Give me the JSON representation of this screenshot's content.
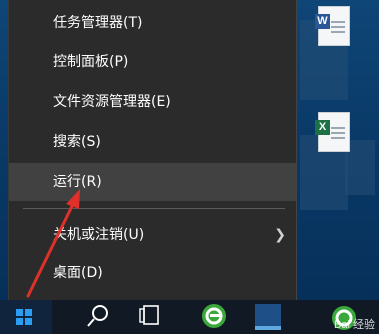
{
  "context_menu": {
    "items": [
      {
        "label": "任务管理器(T)"
      },
      {
        "label": "控制面板(P)"
      },
      {
        "label": "文件资源管理器(E)"
      },
      {
        "label": "搜索(S)"
      },
      {
        "label": "运行(R)"
      },
      {
        "label": "关机或注销(U)"
      },
      {
        "label": "桌面(D)"
      }
    ],
    "highlighted_item": "运行(R)"
  },
  "desktop_icons": [
    {
      "name": "word-document-icon",
      "badge": "W",
      "color": "#2b5797"
    },
    {
      "name": "excel-document-icon",
      "badge": "X",
      "color": "#1e7145"
    }
  ],
  "taskbar": {
    "watermark": "Bai 经验"
  },
  "colors": {
    "menu_bg": "#2b2b2b",
    "highlight_bg": "#414141",
    "arrow": "#e0302a"
  }
}
